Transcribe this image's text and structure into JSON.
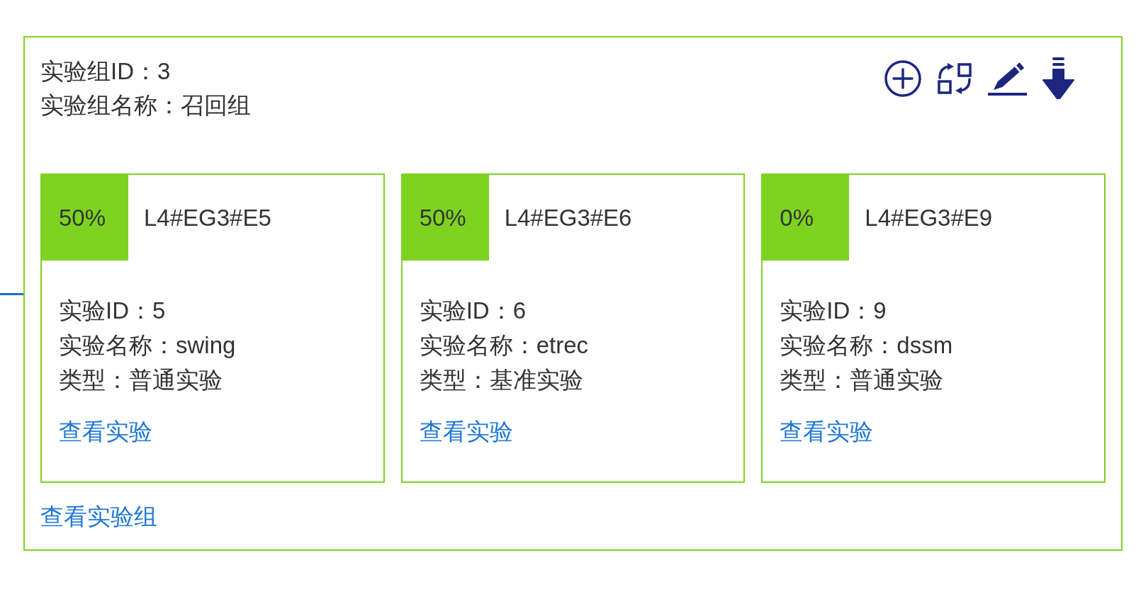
{
  "experiment_group": {
    "id_line": "实验组ID：3",
    "name_line": "实验组名称：召回组",
    "experiments": [
      {
        "traffic": "50%",
        "code": "L4#EG3#E5",
        "details": {
          "id": "实验ID：5",
          "name": "实验名称：swing",
          "type": "类型：普通实验"
        },
        "link": "查看实验"
      },
      {
        "traffic": "50%",
        "code": "L4#EG3#E6",
        "details": {
          "id": "实验ID：6",
          "name": "实验名称：etrec",
          "type": "类型：基准实验"
        },
        "link": "查看实验"
      },
      {
        "traffic": "0%",
        "code": "L4#EG3#E9",
        "details": {
          "id": "实验ID：9",
          "name": "实验名称：dssm",
          "type": "类型：普通实验"
        },
        "link": "查看实验"
      }
    ],
    "link": "查看实验组"
  }
}
